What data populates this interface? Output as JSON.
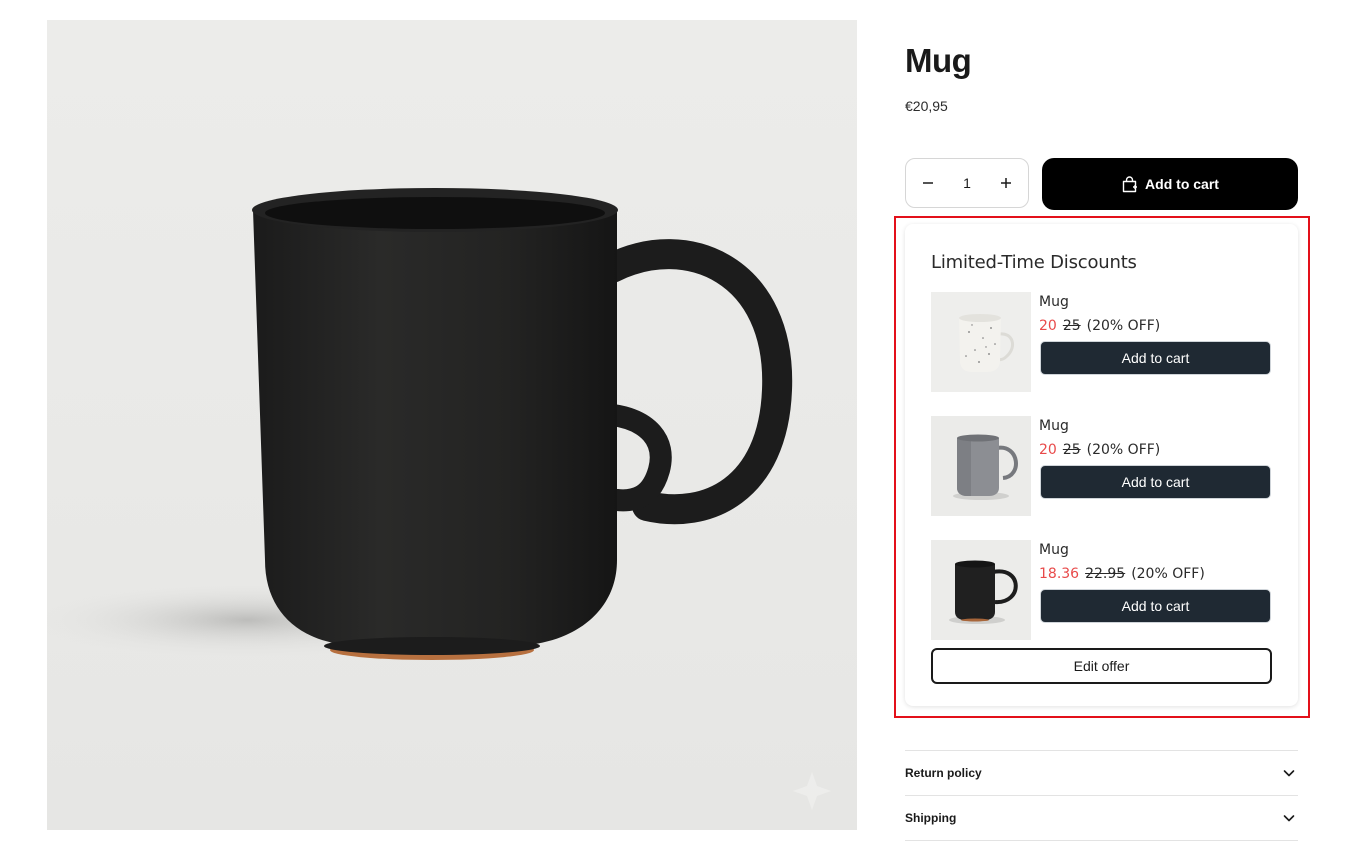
{
  "product": {
    "title": "Mug",
    "price": "€20,95",
    "quantity": "1",
    "add_to_cart_label": "Add to cart",
    "image_icon": "black-mug-photo"
  },
  "discounts": {
    "title": "Limited-Time Discounts",
    "offers": [
      {
        "name": "Mug",
        "price_new": "20",
        "price_old": "25",
        "off": "(20% OFF)",
        "button": "Add to cart",
        "thumb": "speckled-white-mug"
      },
      {
        "name": "Mug",
        "price_new": "20",
        "price_old": "25",
        "off": "(20% OFF)",
        "button": "Add to cart",
        "thumb": "grey-mug"
      },
      {
        "name": "Mug",
        "price_new": "18.36",
        "price_old": "22.95",
        "off": "(20% OFF)",
        "button": "Add to cart",
        "thumb": "black-mug"
      }
    ],
    "edit_label": "Edit offer"
  },
  "accordions": [
    {
      "label": "Return policy"
    },
    {
      "label": "Shipping"
    }
  ],
  "colors": {
    "primary_button": "#000000",
    "offer_button": "#1f2933",
    "sale_price": "#e84a4a",
    "highlight": "#e3101a"
  }
}
